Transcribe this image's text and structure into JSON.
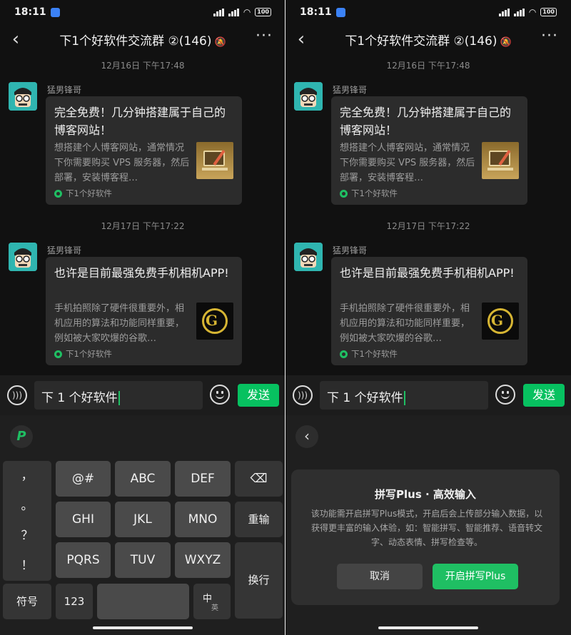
{
  "status": {
    "time": "18:11",
    "battery": "100"
  },
  "header": {
    "title": "下1个好软件交流群 ②(146)"
  },
  "messages": [
    {
      "timestamp": "12月16日 下午17:48",
      "sender": "猛男锋哥",
      "title": "完全免费！几分钟搭建属于自己的博客网站！",
      "desc": "想搭建个人博客网站，通常情况下你需要购买 VPS 服务器，然后部署，安装博客程…",
      "source": "下1个好软件"
    },
    {
      "timestamp": "12月17日 下午17:22",
      "sender": "猛男锋哥",
      "title": "也许是目前最强免费手机相机APP!",
      "desc": "手机拍照除了硬件很重要外，相机应用的算法和功能同样重要，例如被大家吹爆的谷歌…",
      "source": "下1个好软件"
    }
  ],
  "input": {
    "value": "下 1 个好软件",
    "send_label": "发送"
  },
  "keyboard": {
    "punct": [
      "，",
      "。",
      "？",
      "！"
    ],
    "row1": [
      "@#",
      "ABC",
      "DEF"
    ],
    "row2": [
      "GHI",
      "JKL",
      "MNO"
    ],
    "row3": [
      "PQRS",
      "TUV",
      "WXYZ"
    ],
    "reenter": "重输",
    "newline": "换行",
    "symbols": "符号",
    "num": "123",
    "lang_main": "中",
    "lang_sub": "英"
  },
  "dialog": {
    "title": "拼写Plus · 高效输入",
    "body": "该功能需开启拼写Plus模式，开启后会上传部分输入数据，以获得更丰富的输入体验，如：智能拼写、智能推荐、语音转文字、动态表情、拼写检查等。",
    "cancel": "取消",
    "confirm": "开启拼写Plus"
  },
  "colors": {
    "accent": "#07c160",
    "background": "#111111",
    "card": "#2c2c2c"
  }
}
